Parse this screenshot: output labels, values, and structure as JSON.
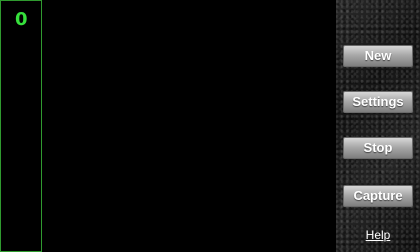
{
  "score": {
    "value": "0"
  },
  "controls": {
    "new_label": "New",
    "settings_label": "Settings",
    "stop_label": "Stop",
    "capture_label": "Capture",
    "help_label": "Help"
  },
  "colors": {
    "score_text": "#36e03c",
    "score_border": "#2f9a2f",
    "background": "#000000",
    "button_text": "#ffffff"
  }
}
